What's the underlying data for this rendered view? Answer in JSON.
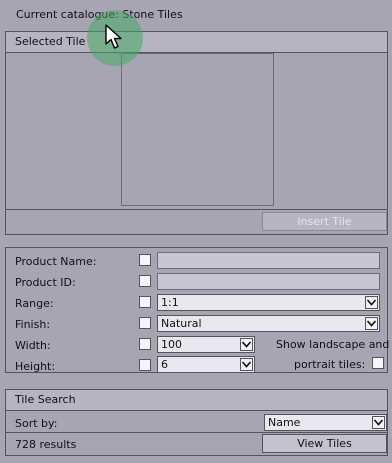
{
  "catalogue_title": "Current catalogue: Stone Tiles",
  "selected_tile": {
    "header": "Selected Tile",
    "insert_button": "Insert Tile"
  },
  "properties": {
    "product_name_label": "Product Name:",
    "product_name_value": "",
    "product_id_label": "Product ID:",
    "product_id_value": "",
    "range_label": "Range:",
    "range_value": "1:1",
    "finish_label": "Finish:",
    "finish_value": "Natural",
    "width_label": "Width:",
    "width_value": "100",
    "height_label": "Height:",
    "height_value": "6",
    "show_tiles_line1": "Show landscape and",
    "show_tiles_line2": "portrait tiles:"
  },
  "tile_search": {
    "header": "Tile Search",
    "sort_label": "Sort by:",
    "sort_value": "Name",
    "results_text": "728 results",
    "view_button": "View Tiles"
  },
  "colors": {
    "panel_bg": "#a8a5b3",
    "header_bg": "#b7b4c1",
    "cursor_highlight": "#46aa64"
  }
}
